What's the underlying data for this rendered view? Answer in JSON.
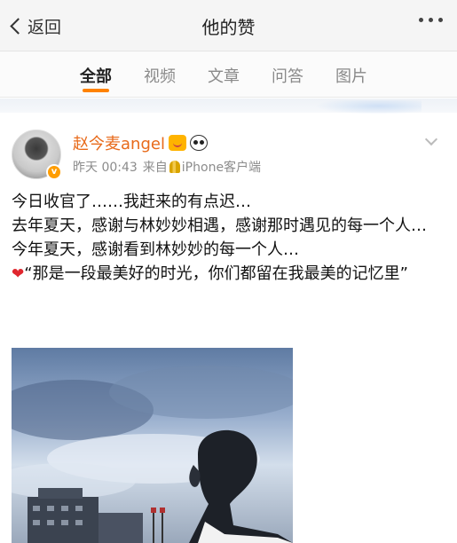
{
  "nav": {
    "back_label": "返回",
    "title": "他的赞"
  },
  "tabs": [
    {
      "label": "全部",
      "active": true
    },
    {
      "label": "视频",
      "active": false
    },
    {
      "label": "文章",
      "active": false
    },
    {
      "label": "问答",
      "active": false
    },
    {
      "label": "图片",
      "active": false
    }
  ],
  "post": {
    "username": "赵今麦angel",
    "time": "昨天 00:43",
    "source": "来自",
    "device": "iPhone客户端",
    "verified_badge": "v",
    "lines": [
      "今日收官了……我赶来的有点迟…",
      "去年夏天，感谢与林妙妙相遇，感谢那时遇见的每一个人…",
      "今年夏天，感谢看到林妙妙的每一个人…"
    ],
    "quote": "“那是一段最美好的时光，你们都留在我最美的记忆里”",
    "icons": [
      "vip-face-icon",
      "panda-icon",
      "heart-icon",
      "wheat-icon",
      "chevron-down-icon"
    ]
  },
  "colors": {
    "accent": "#ff8200",
    "username": "#e86a1a",
    "heart": "#e0262e"
  }
}
